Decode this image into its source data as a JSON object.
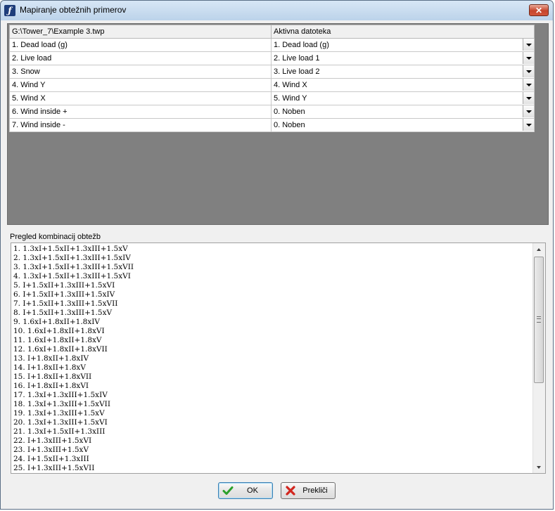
{
  "window": {
    "title": "Mapiranje obtežnih primerov",
    "app_icon_letter": "ƒ",
    "close_symbol": "✕"
  },
  "mapping": {
    "source_header": "G:\\Tower_7\\Example 3.twp",
    "target_header": "Aktivna datoteka",
    "rows": [
      {
        "source": "1. Dead load (g)",
        "target": "1. Dead load (g)"
      },
      {
        "source": "2. Live load",
        "target": "2. Live load 1"
      },
      {
        "source": "3. Snow",
        "target": "3. Live load 2"
      },
      {
        "source": "4. Wind Y",
        "target": "4. Wind X"
      },
      {
        "source": "5. Wind X",
        "target": "5. Wind Y"
      },
      {
        "source": "6. Wind inside  +",
        "target": "0. Noben"
      },
      {
        "source": "7. Wind inside  -",
        "target": "0. Noben"
      }
    ]
  },
  "summary": {
    "label": "Pregled kombinacij obtežb",
    "items": [
      "1. 1.3xI+1.5xII+1.3xIII+1.5xV",
      "2. 1.3xI+1.5xII+1.3xIII+1.5xIV",
      "3. 1.3xI+1.5xII+1.3xIII+1.5xVII",
      "4. 1.3xI+1.5xII+1.3xIII+1.5xVI",
      "5. I+1.5xII+1.3xIII+1.5xVI",
      "6. I+1.5xII+1.3xIII+1.5xIV",
      "7. I+1.5xII+1.3xIII+1.5xVII",
      "8. I+1.5xII+1.3xIII+1.5xV",
      "9. 1.6xI+1.8xII+1.8xIV",
      "10. 1.6xI+1.8xII+1.8xVI",
      "11. 1.6xI+1.8xII+1.8xV",
      "12. 1.6xI+1.8xII+1.8xVII",
      "13. I+1.8xII+1.8xIV",
      "14. I+1.8xII+1.8xV",
      "15. I+1.8xII+1.8xVII",
      "16. I+1.8xII+1.8xVI",
      "17. 1.3xI+1.3xIII+1.5xIV",
      "18. 1.3xI+1.3xIII+1.5xVII",
      "19. 1.3xI+1.3xIII+1.5xV",
      "20. 1.3xI+1.3xIII+1.5xVI",
      "21. 1.3xI+1.5xII+1.3xIII",
      "22. I+1.3xIII+1.5xVI",
      "23. I+1.3xIII+1.5xV",
      "24. I+1.5xII+1.3xIII",
      "25. I+1.3xIII+1.5xVII"
    ]
  },
  "buttons": {
    "ok_label": "OK",
    "cancel_label": "Prekliči"
  },
  "icons": {
    "ok": "checkmark-icon",
    "cancel": "x-mark-icon"
  },
  "colors": {
    "ok_icon": "#2aa02a",
    "cancel_icon": "#d2261e",
    "grid_background": "#808080"
  }
}
